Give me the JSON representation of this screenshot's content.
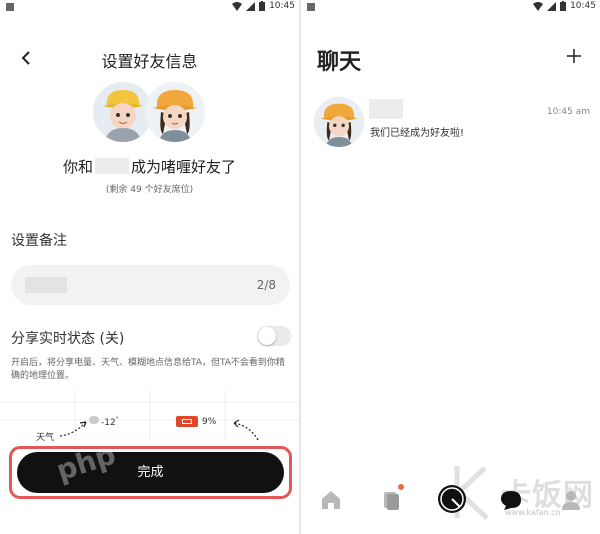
{
  "status_bar": {
    "time": "10:45"
  },
  "left": {
    "title": "设置好友信息",
    "friend_prefix": "你和",
    "friend_suffix": "成为啫喱好友了",
    "remaining_slots": "(剩余 49 个好友席位)",
    "remark_label": "设置备注",
    "remark_count": "2/8",
    "share_label": "分享实时状态 (关)",
    "share_enabled": false,
    "share_description": "开启后，将分享电量、天气、模糊地点信息给TA，但TA不会看到你精确的地理位置。",
    "preview": {
      "weather_label": "天气",
      "temperature": "-12",
      "temperature_unit": "°",
      "battery": "9%"
    },
    "done_button": "完成",
    "watermark": "php"
  },
  "right": {
    "title": "聊天",
    "chat": {
      "time": "10:45 am",
      "message": "我们已经成为好友啦!"
    },
    "tabs": [
      "home",
      "cards",
      "camera",
      "chat",
      "profile"
    ],
    "watermark": "卡饭网",
    "watermark_url": "www.kafan.cn"
  },
  "colors": {
    "accent": "#111111",
    "badge": "#e8703c",
    "highlight": "#e55656",
    "battery": "#e0462c"
  }
}
